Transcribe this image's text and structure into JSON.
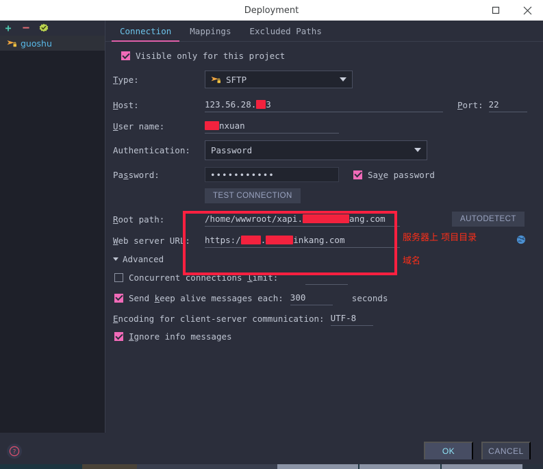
{
  "window": {
    "title": "Deployment",
    "maximize_icon": "maximize-icon",
    "close_icon": "close-icon"
  },
  "sidebar": {
    "toolbar": {
      "add_label": "+",
      "remove_label": "−",
      "default_icon": "check-badge-icon"
    },
    "items": [
      {
        "label": "guoshu",
        "icon": "sftp-server-icon"
      }
    ]
  },
  "tabs": [
    {
      "label": "Connection",
      "active": true
    },
    {
      "label": "Mappings",
      "active": false
    },
    {
      "label": "Excluded Paths",
      "active": false
    }
  ],
  "form": {
    "visible_only": {
      "label": "Visible only for this project",
      "checked": true
    },
    "type": {
      "label": "Type:",
      "value": "SFTP",
      "icon": "sftp-icon"
    },
    "host": {
      "label": "Host:",
      "value_prefix": "123.56.28.",
      "value_suffix": "3",
      "redacted": true
    },
    "port": {
      "label": "Port:",
      "value": "22"
    },
    "username": {
      "label": "User name:",
      "value_suffix": "nxuan",
      "redacted": true
    },
    "authentication": {
      "label": "Authentication:",
      "value": "Password"
    },
    "password": {
      "label": "Password:",
      "value": "•••••••••••"
    },
    "save_password": {
      "label": "Save password",
      "checked": true
    },
    "test_connection": {
      "label": "TEST CONNECTION"
    },
    "root_path": {
      "label": "Root path:",
      "value_prefix": "/home/wwwroot/xapi.",
      "value_suffix": "ang.com",
      "redacted": true
    },
    "autodetect": {
      "label": "AUTODETECT"
    },
    "web_server_url": {
      "label": "Web server URL:",
      "value_prefix": "https:/",
      "value_mid": ".",
      "value_suffix": "inkang.com",
      "redacted": true,
      "open_icon": "globe-icon"
    },
    "advanced": {
      "label": "Advanced",
      "expanded": true
    },
    "concurrent": {
      "label": "Concurrent connections limit:",
      "checked": false,
      "value": ""
    },
    "keepalive": {
      "label": "Send keep alive messages each:",
      "checked": true,
      "value": "300",
      "unit": "seconds"
    },
    "encoding": {
      "label": "Encoding for client-server communication:",
      "value": "UTF-8"
    },
    "ignore_info": {
      "label": "Ignore info messages",
      "checked": true
    }
  },
  "annotations": [
    {
      "text": "服务器上 项目目录",
      "color": "#ff2f18"
    },
    {
      "text": "域名",
      "color": "#ff2f18"
    }
  ],
  "footer": {
    "help_icon": "help-icon",
    "ok_label": "OK",
    "cancel_label": "CANCEL"
  },
  "colors": {
    "accent_pink": "#e05fa8",
    "tab_active": "#6cc3ea",
    "annotation_red": "#ff2f18",
    "highlight_box": "#ff2040",
    "background": "#2b2e3b",
    "sidebar_bg": "#1e2029"
  }
}
